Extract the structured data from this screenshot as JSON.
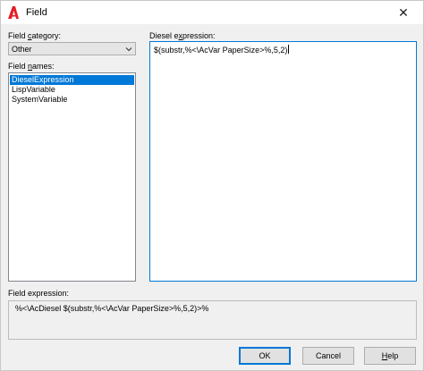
{
  "window": {
    "title": "Field",
    "close_glyph": "✕"
  },
  "field_category": {
    "label_prefix": "Field ",
    "label_mnemonic": "c",
    "label_suffix": "ategory:",
    "selected": "Other"
  },
  "field_names": {
    "label_prefix": "Field ",
    "label_mnemonic": "n",
    "label_suffix": "ames:",
    "items": [
      "DieselExpression",
      "LispVariable",
      "SystemVariable"
    ],
    "selected_index": 0
  },
  "diesel_expression": {
    "label_prefix": "Diesel e",
    "label_mnemonic": "x",
    "label_suffix": "pression:",
    "value": "$(substr,%<\\AcVar PaperSize>%,5,2)"
  },
  "field_expression": {
    "label": "Field expression:",
    "value": "%<\\AcDiesel $(substr,%<\\AcVar PaperSize>%,5,2)>%"
  },
  "buttons": {
    "ok": "OK",
    "cancel": "Cancel",
    "help_mnemonic": "H",
    "help_rest": "elp"
  },
  "icons": {
    "app": "autocad-logo-icon",
    "close": "close-icon",
    "dropdown": "chevron-down-icon"
  },
  "colors": {
    "selection": "#0078d7",
    "app_logo": "#e51e25"
  }
}
